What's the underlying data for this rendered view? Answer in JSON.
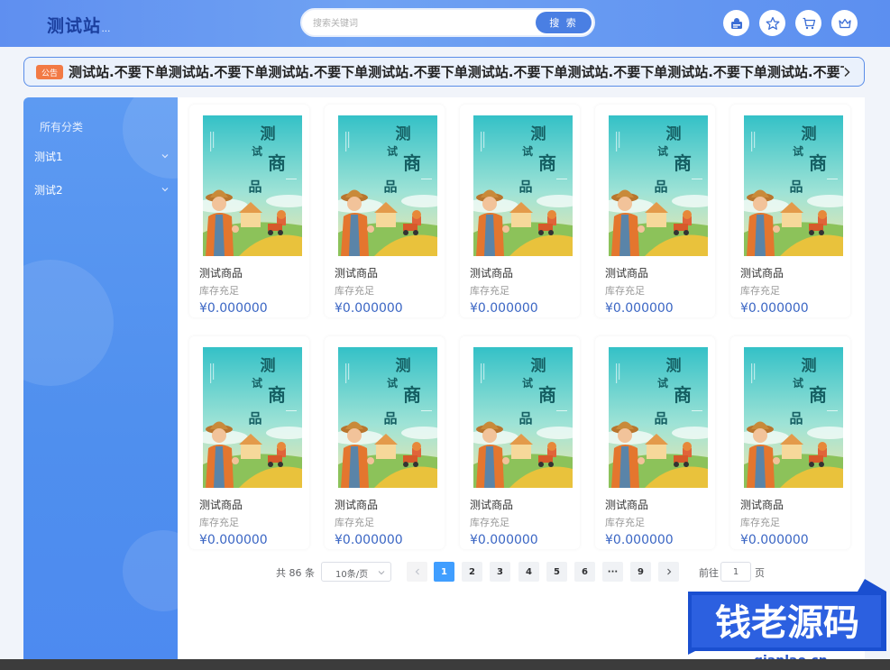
{
  "header": {
    "logo": "测试站",
    "logo_sub": "...",
    "search_placeholder": "搜索关键词",
    "search_button": "搜 索",
    "icons": [
      "user-id-icon",
      "star-icon",
      "cart-icon",
      "crown-icon"
    ]
  },
  "notice": {
    "tag": "公告",
    "text": "测试站.不要下单测试站.不要下单测试站.不要下单测试站.不要下单测试站.不要下单测试站.不要下单测试站.不要下单测试站.不要下单"
  },
  "sidebar": {
    "title": "所有分类",
    "items": [
      {
        "label": "测试1"
      },
      {
        "label": "测试2"
      }
    ]
  },
  "products": [
    {
      "name": "测试商品",
      "stock": "库存充足",
      "price": "¥0.000000"
    },
    {
      "name": "测试商品",
      "stock": "库存充足",
      "price": "¥0.000000"
    },
    {
      "name": "测试商品",
      "stock": "库存充足",
      "price": "¥0.000000"
    },
    {
      "name": "测试商品",
      "stock": "库存充足",
      "price": "¥0.000000"
    },
    {
      "name": "测试商品",
      "stock": "库存充足",
      "price": "¥0.000000"
    },
    {
      "name": "测试商品",
      "stock": "库存充足",
      "price": "¥0.000000"
    },
    {
      "name": "测试商品",
      "stock": "库存充足",
      "price": "¥0.000000"
    },
    {
      "name": "测试商品",
      "stock": "库存充足",
      "price": "¥0.000000"
    },
    {
      "name": "测试商品",
      "stock": "库存充足",
      "price": "¥0.000000"
    },
    {
      "name": "测试商品",
      "stock": "库存充足",
      "price": "¥0.000000"
    }
  ],
  "product_image_text": [
    "测",
    "试",
    "商",
    "品"
  ],
  "pagination": {
    "total": "共 86 条",
    "page_size": "10条/页",
    "pages": [
      "1",
      "2",
      "3",
      "4",
      "5",
      "6",
      "···",
      "9"
    ],
    "current": "1",
    "goto_label": "前往",
    "goto_value": "1",
    "page_suffix": "页"
  },
  "watermark": {
    "brand": "钱老源码",
    "url": "qianlao.cn"
  },
  "colors": {
    "header": "#6fa2f3",
    "sidebar": "#5d9af2",
    "price": "#3b66c4",
    "notice_tag": "#f27a45",
    "active_page": "#409eff"
  }
}
